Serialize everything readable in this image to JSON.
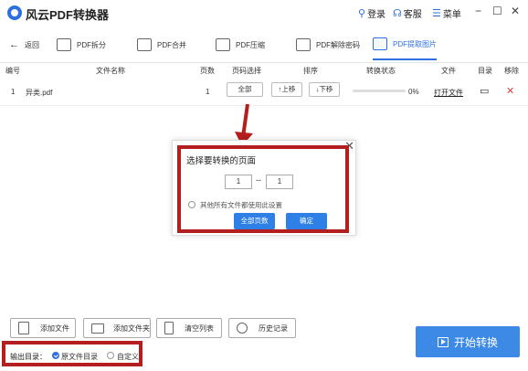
{
  "app": {
    "title": "风云PDF转换器"
  },
  "titlebar": {
    "login": "登录",
    "service": "客服",
    "menu": "菜单",
    "minimize": "−",
    "maximize": "☐",
    "close": "✕"
  },
  "toolbar": {
    "back": "返回",
    "tools": [
      "PDF拆分",
      "PDF合并",
      "PDF压缩",
      "PDF解除密码",
      "PDF提取图片"
    ],
    "active": "PDF提取图片"
  },
  "table": {
    "headers": [
      "编号",
      "文件名称",
      "页数",
      "页码选择",
      "排序",
      "转换状态",
      "文件",
      "目录",
      "移除"
    ],
    "rows": [
      {
        "index": "1",
        "name": "异类.pdf",
        "pages": "1",
        "page_select": "全部",
        "move_up": "↑上移",
        "move_down": "↓下移",
        "status": "0%",
        "progress": 0,
        "open": "打开文件"
      }
    ]
  },
  "dialog": {
    "title": "选择要转换的页面",
    "from": "1",
    "separator": "--",
    "to": "1",
    "apply_all": "其他所有文件都使用此设置",
    "all_pages": "全部页数",
    "confirm": "确定"
  },
  "bottom": {
    "add_file": "添加文件",
    "add_folder": "添加文件夹",
    "clear_list": "清空列表",
    "history": "历史记录",
    "output_label": "输出目录：",
    "source_dir": "原文件目录",
    "custom": "自定义",
    "start": "开始转换"
  },
  "colors": {
    "accent": "#2e6fe0",
    "annotation": "#b41e1e",
    "start_button": "#3d8ae6"
  }
}
